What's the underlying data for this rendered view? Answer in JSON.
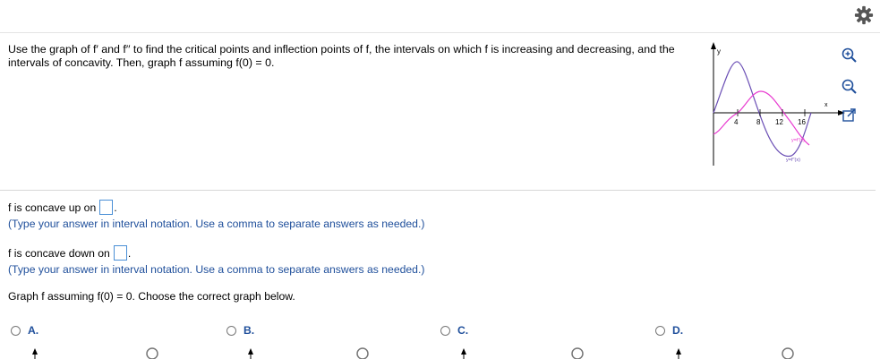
{
  "toolbar": {
    "settings_icon": "gear-icon"
  },
  "question": {
    "text": "Use the graph of f′ and f′′ to find the critical points and inflection points of f, the intervals on which f is increasing and decreasing, and the intervals of concavity. Then, graph f assuming f(0) = 0."
  },
  "graph": {
    "y_axis_label": "y",
    "x_axis_label": "x",
    "tick_labels": [
      "4",
      "8",
      "12",
      "16"
    ],
    "curve1_label": "y=f′(x)",
    "curve2_label": "y=f′′(x)",
    "colors": {
      "f_prime": "#6b4fb5",
      "f_double_prime": "#e83bd0"
    }
  },
  "zoom_tools": {
    "zoom_in": "zoom-in-icon",
    "zoom_out": "zoom-out-icon",
    "popout": "popout-icon"
  },
  "part1": {
    "prompt": "f is concave up on",
    "period": ".",
    "hint": "(Type your answer in interval notation. Use a comma to separate answers as needed.)"
  },
  "part2": {
    "prompt": "f is concave down on",
    "period": ".",
    "hint": "(Type your answer in interval notation. Use a comma to separate answers as needed.)"
  },
  "part3": {
    "prompt": "Graph f assuming f(0) = 0. Choose the correct graph below."
  },
  "choices": [
    {
      "label": "A."
    },
    {
      "label": "B."
    },
    {
      "label": "C."
    },
    {
      "label": "D."
    }
  ]
}
